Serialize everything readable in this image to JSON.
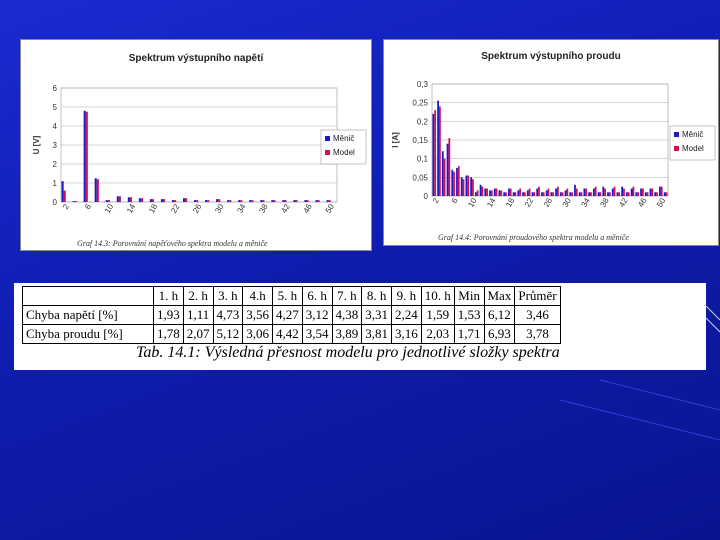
{
  "colors": {
    "menic": "#1a1acc",
    "model": "#cc1155",
    "background": "#1020c0"
  },
  "chart_data": [
    {
      "type": "bar",
      "title": "Spektrum výstupního napětí",
      "ylabel": "U [V]",
      "xlabel": "",
      "ylim": [
        0,
        6
      ],
      "yticks": [
        "0",
        "1",
        "2",
        "3",
        "4",
        "5",
        "6"
      ],
      "xticks": [
        "2",
        "6",
        "10",
        "14",
        "18",
        "22",
        "26",
        "30",
        "34",
        "38",
        "42",
        "46",
        "50"
      ],
      "categories": [
        1,
        2,
        3,
        4,
        5,
        6,
        7,
        8,
        9,
        10,
        11,
        12,
        13,
        14,
        15,
        16,
        17,
        18,
        19,
        20,
        21,
        22,
        23,
        24,
        25,
        26,
        27,
        28,
        29,
        30,
        31,
        32,
        33,
        34,
        35,
        36,
        37,
        38,
        39,
        40,
        41,
        42,
        43,
        44,
        45,
        46,
        47,
        48,
        49,
        50
      ],
      "series": [
        {
          "name": "Měnič",
          "values": [
            1.1,
            0,
            0.05,
            0,
            4.8,
            0,
            1.25,
            0,
            0.1,
            0,
            0.3,
            0,
            0.25,
            0,
            0.2,
            0,
            0.15,
            0,
            0.15,
            0,
            0.1,
            0,
            0.2,
            0,
            0.1,
            0,
            0.1,
            0,
            0.15,
            0,
            0.1,
            0,
            0.1,
            0,
            0.1,
            0,
            0.1,
            0,
            0.1,
            0,
            0.1,
            0,
            0.1,
            0,
            0.1,
            0,
            0.1,
            0,
            0.1,
            0
          ]
        },
        {
          "name": "Model",
          "values": [
            0.6,
            0,
            0.05,
            0,
            4.75,
            0,
            1.2,
            0,
            0.1,
            0,
            0.3,
            0,
            0.25,
            0,
            0.2,
            0,
            0.15,
            0,
            0.15,
            0,
            0.1,
            0,
            0.2,
            0,
            0.1,
            0,
            0.1,
            0,
            0.15,
            0,
            0.1,
            0,
            0.1,
            0,
            0.1,
            0,
            0.1,
            0,
            0.1,
            0,
            0.1,
            0,
            0.1,
            0,
            0.1,
            0,
            0.1,
            0,
            0.1,
            0
          ]
        }
      ],
      "legend": "right",
      "grid": true,
      "caption": "Graf 14.3: Porovnání napěťového spektra modelu a měniče"
    },
    {
      "type": "bar",
      "title": "Spektrum výstupního proudu",
      "ylabel": "I [A]",
      "xlabel": "",
      "ylim": [
        0,
        0.3
      ],
      "yticks": [
        "0",
        "0,05",
        "0,1",
        "0,15",
        "0,2",
        "0,25",
        "0,3"
      ],
      "xticks": [
        "2",
        "6",
        "10",
        "14",
        "18",
        "22",
        "26",
        "30",
        "34",
        "38",
        "42",
        "46",
        "50"
      ],
      "categories": [
        1,
        2,
        3,
        4,
        5,
        6,
        7,
        8,
        9,
        10,
        11,
        12,
        13,
        14,
        15,
        16,
        17,
        18,
        19,
        20,
        21,
        22,
        23,
        24,
        25,
        26,
        27,
        28,
        29,
        30,
        31,
        32,
        33,
        34,
        35,
        36,
        37,
        38,
        39,
        40,
        41,
        42,
        43,
        44,
        45,
        46,
        47,
        48,
        49,
        50
      ],
      "series": [
        {
          "name": "Měnič",
          "values": [
            0.22,
            0.255,
            0.12,
            0.14,
            0.07,
            0.075,
            0.05,
            0.055,
            0.05,
            0.01,
            0.03,
            0.02,
            0.015,
            0.02,
            0.015,
            0.01,
            0.02,
            0.01,
            0.015,
            0.01,
            0.015,
            0.01,
            0.02,
            0.01,
            0.015,
            0.01,
            0.02,
            0.01,
            0.015,
            0.01,
            0.03,
            0.01,
            0.02,
            0.01,
            0.02,
            0.01,
            0.025,
            0.01,
            0.02,
            0.01,
            0.025,
            0.01,
            0.02,
            0.01,
            0.02,
            0.01,
            0.02,
            0.01,
            0.025,
            0.01
          ]
        },
        {
          "name": "Model",
          "values": [
            0.23,
            0.24,
            0.1,
            0.155,
            0.065,
            0.08,
            0.045,
            0.055,
            0.045,
            0.015,
            0.025,
            0.02,
            0.015,
            0.02,
            0.015,
            0.01,
            0.02,
            0.01,
            0.02,
            0.01,
            0.02,
            0.01,
            0.025,
            0.01,
            0.02,
            0.01,
            0.025,
            0.01,
            0.02,
            0.01,
            0.02,
            0.01,
            0.02,
            0.01,
            0.025,
            0.01,
            0.02,
            0.01,
            0.025,
            0.01,
            0.02,
            0.01,
            0.025,
            0.01,
            0.02,
            0.01,
            0.02,
            0.01,
            0.025,
            0.01
          ]
        }
      ],
      "legend": "right",
      "grid": true,
      "caption": "Graf 14.4: Porovnání proudového spektra modelu a měniče"
    },
    {
      "type": "table",
      "header": [
        "",
        "1. h",
        "2. h",
        "3. h",
        "4.h",
        "5. h",
        "6. h",
        "7. h",
        "8. h",
        "9. h",
        "10. h",
        "Min",
        "Max",
        "Průměr"
      ],
      "rows": [
        [
          "Chyba napětí [%]",
          "1,93",
          "1,11",
          "4,73",
          "3,56",
          "4,27",
          "3,12",
          "4,38",
          "3,31",
          "2,24",
          "1,59",
          "1,53",
          "6,12",
          "3,46"
        ],
        [
          "Chyba proudu [%]",
          "1,78",
          "2,07",
          "5,12",
          "3,06",
          "4,42",
          "3,54",
          "3,89",
          "3,81",
          "3,16",
          "2,03",
          "1,71",
          "6,93",
          "3,78"
        ]
      ],
      "caption": "Tab. 14.1: Výsledná přesnost modelu pro jednotlivé složky spektra"
    }
  ]
}
